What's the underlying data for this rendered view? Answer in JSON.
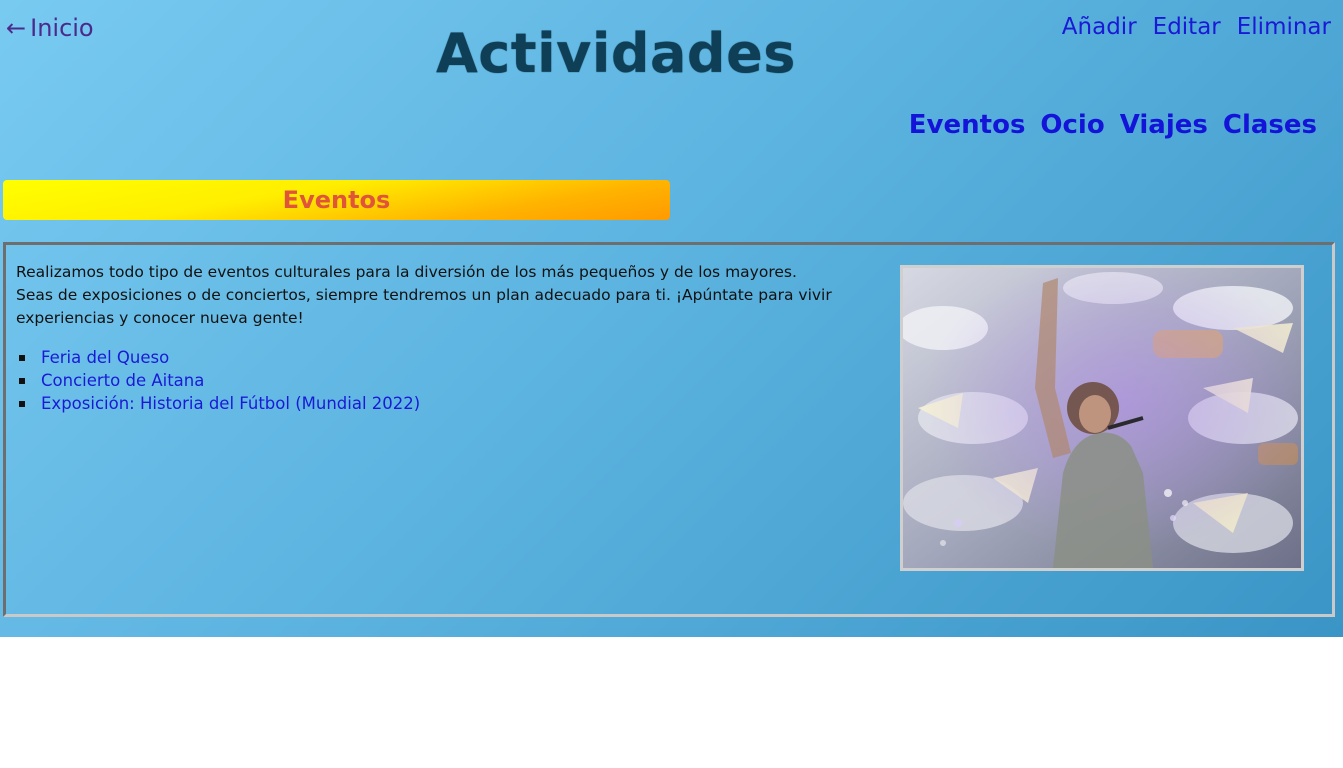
{
  "header": {
    "back_arrow": "←",
    "back_label": "Inicio",
    "title": "Actividades",
    "admin_menu": [
      "Añadir",
      "Editar",
      "Eliminar"
    ]
  },
  "nav": {
    "items": [
      "Eventos",
      "Ocio",
      "Viajes",
      "Clases"
    ]
  },
  "section": {
    "heading": "Eventos",
    "description": "Realizamos todo tipo de eventos culturales para la diversión de los más pequeños y de los mayores. Seas de exposiciones o de conciertos, siempre tendremos un plan adecuado para ti. ¡Apúntate para vivir experiencias y conocer nueva gente!",
    "events": [
      "Feria del Queso",
      "Concierto de Aitana",
      "Exposición: Historia del Fútbol (Mundial 2022)"
    ]
  },
  "colors": {
    "background_start": "#78caf1",
    "background_end": "#3a95c6",
    "title": "#0f3f57",
    "link": "#1a1ad6",
    "banner_start": "#ffff00",
    "banner_end": "#ff9a00",
    "banner_text": "#e0553a"
  }
}
